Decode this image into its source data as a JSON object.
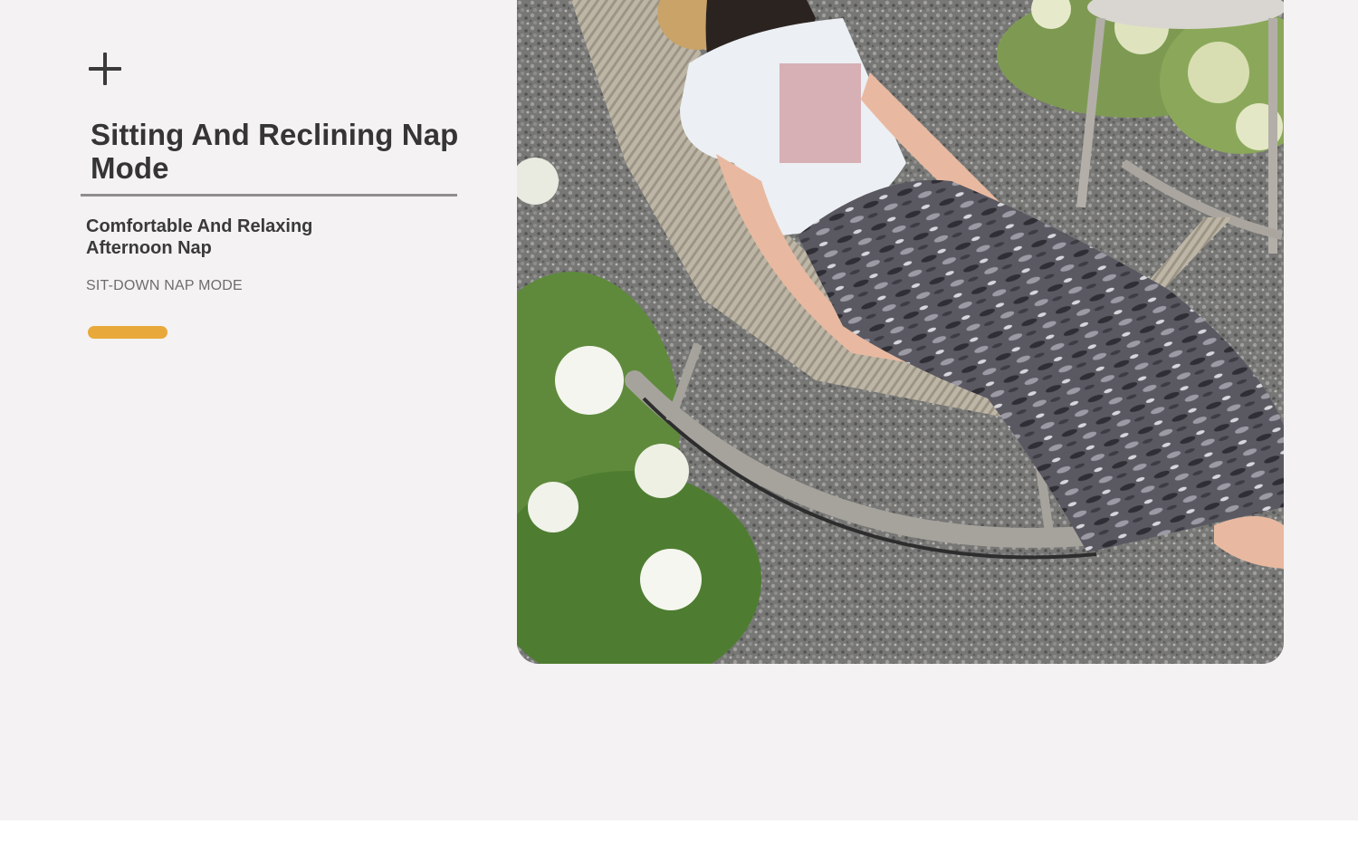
{
  "section": {
    "title": "Sitting And Reclining Nap Mode",
    "subtitle": "Comfortable And Relaxing\nAfternoon Nap",
    "mode_label": "SIT-DOWN NAP MODE",
    "accent_color": "#e8a93a",
    "icon": "plus-icon"
  },
  "photo": {
    "icon": "product-photo"
  }
}
